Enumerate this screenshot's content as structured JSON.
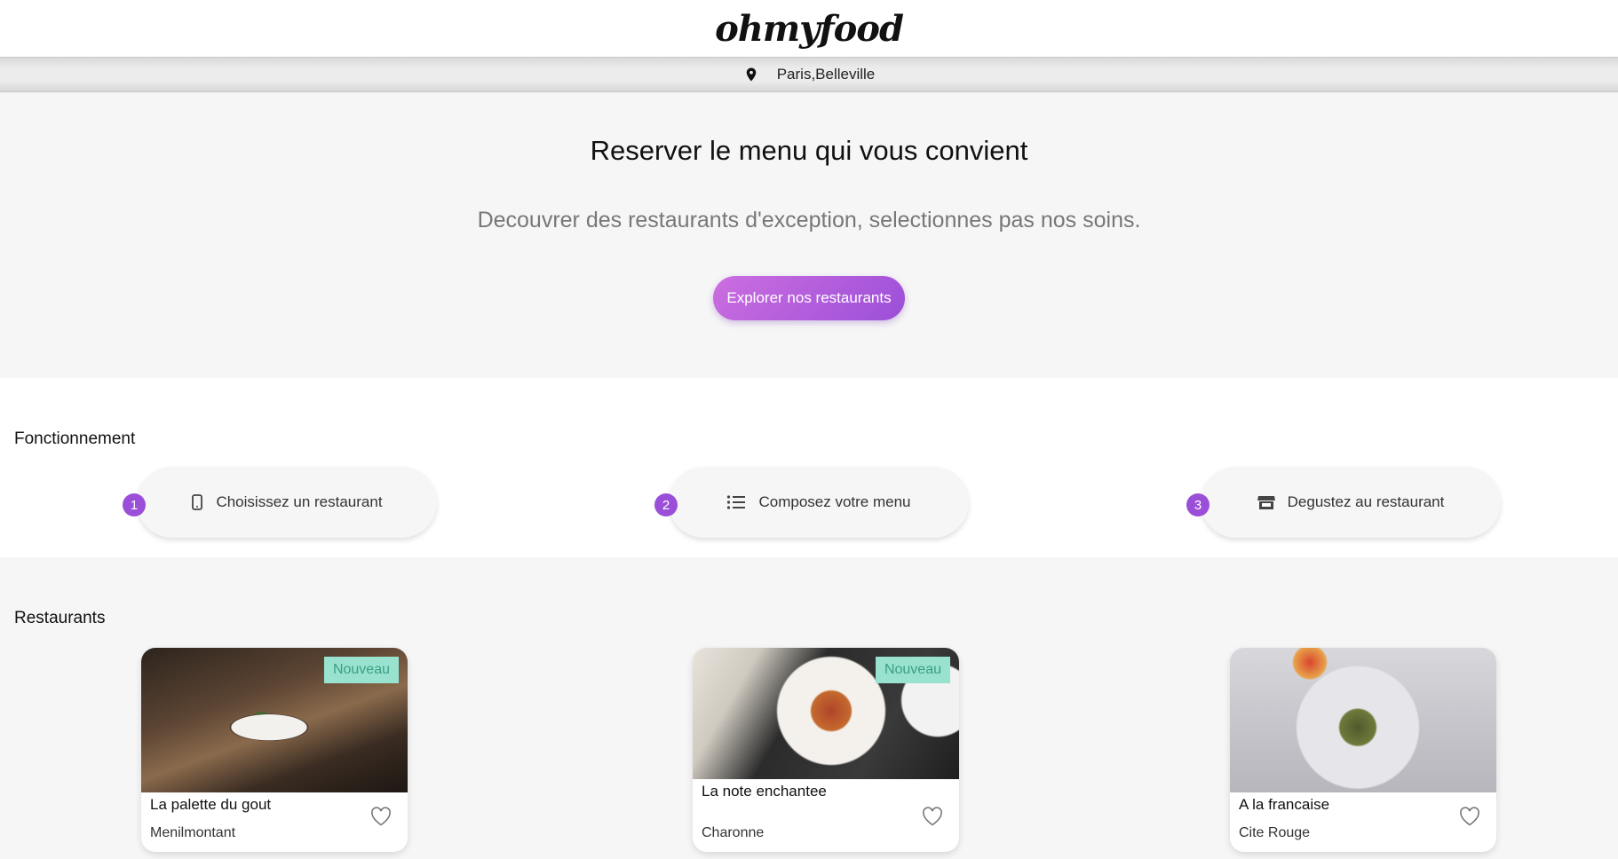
{
  "header": {
    "logo": "ohmyfood"
  },
  "location": {
    "text": "Paris,Belleville",
    "icon": "map-pin-icon"
  },
  "hero": {
    "title": "Reserver le menu qui vous convient",
    "subtitle": "Decouvrer des restaurants d'exception, selectionnes pas nos soins.",
    "button": "Explorer nos restaurants"
  },
  "how": {
    "title": "Fonctionnement",
    "steps": [
      {
        "num": "1",
        "label": "Choisissez un restaurant",
        "icon": "mobile-phone-icon"
      },
      {
        "num": "2",
        "label": "Composez votre menu",
        "icon": "list-icon"
      },
      {
        "num": "3",
        "label": "Degustez au restaurant",
        "icon": "store-icon"
      }
    ]
  },
  "restaurants": {
    "title": "Restaurants",
    "items": [
      {
        "name": "La palette du gout",
        "area": "Menilmontant",
        "badge": "Nouveau"
      },
      {
        "name": "La note enchantee",
        "area": "Charonne",
        "badge": "Nouveau"
      },
      {
        "name": "A la francaise",
        "area": "Cite Rouge",
        "badge": ""
      }
    ]
  },
  "colors": {
    "accent": "#9b4fd8",
    "badge_bg": "#99e2d0",
    "badge_text": "#3a9e85"
  }
}
